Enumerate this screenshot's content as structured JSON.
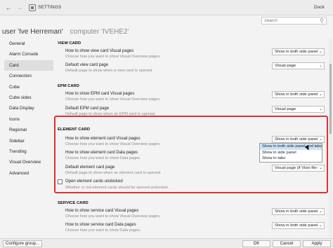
{
  "window": {
    "title": "SETTINGS",
    "dock_label": "Dock"
  },
  "search": {
    "placeholder": "Search"
  },
  "context": {
    "user": "user 'Ive Herreman'",
    "computer": "computer 'IVEHE2'"
  },
  "sidebar": {
    "items": [
      {
        "label": "General"
      },
      {
        "label": "Alarm Console"
      },
      {
        "label": "Card"
      },
      {
        "label": "Connection"
      },
      {
        "label": "Cube"
      },
      {
        "label": "Cube sides"
      },
      {
        "label": "Data Display"
      },
      {
        "label": "Icons"
      },
      {
        "label": "Regional"
      },
      {
        "label": "Sidebar"
      },
      {
        "label": "Trending"
      },
      {
        "label": "Visual Overview"
      },
      {
        "label": "Advanced"
      }
    ],
    "active_index": 2
  },
  "sections": {
    "view_card": {
      "title": "VIEW CARD",
      "s1_label": "How to show view card Visual pages",
      "s1_desc": "Choose how you want to show Visual Overview pages.",
      "s1_value": "Show in both side panel",
      "s2_label": "Default view card page",
      "s2_desc": "Default page to show when a view card is opened.",
      "s2_value": "Visual page"
    },
    "epm_card": {
      "title": "EPM CARD",
      "s1_label": "How to show EPM card Visual pages",
      "s1_desc": "Choose how you want to show Visual Overview pages.",
      "s1_value": "Show in both side panel",
      "s2_label": "Default EPM card page",
      "s2_desc": "Default page to show when an EPM card is opened.",
      "s2_value": "Visual page"
    },
    "element_card": {
      "title": "ELEMENT CARD",
      "s1_label": "How to show element card Visual pages",
      "s1_desc": "Choose how you want to show Visual Overview pages.",
      "s1_value": "Show in both side panel",
      "s2_label": "How to show element card Data pages",
      "s2_desc": "Choose how you want to show Data pages.",
      "s3_label": "Default element card page",
      "s3_desc": "Default page to show when an element card is opened.",
      "s3_value": "Visual page (if Visio file in",
      "chk_label": "Open element cards undocked",
      "chk_desc": "Whether or not element cards should be opened undocked."
    },
    "service_card": {
      "title": "SERVICE CARD",
      "s1_label": "How to show service card Visual pages",
      "s1_desc": "Choose how you want to show Visual Overview pages.",
      "s1_value": "Show in both side panel",
      "s2_label": "How to show service card Data pages",
      "s2_desc": "Choose how you want to show Data pages.",
      "s2_value": "Show in both side panel"
    }
  },
  "dropdown": {
    "options": [
      {
        "label": "Show in both side panel and tabs"
      },
      {
        "label": "Show in side panel"
      },
      {
        "label": "Show in tabs"
      }
    ],
    "selected_index": 0
  },
  "footer": {
    "config_group": "Configure group...",
    "ok": "OK",
    "cancel": "Cancel",
    "apply": "Apply"
  },
  "colors": {
    "highlight": "#e03030",
    "selected_option": "#cce4f7",
    "active_item": "#dedede"
  },
  "icons": {
    "back": "back-arrow-icon",
    "search": "search-icon",
    "dropdown": "chevron-down-icon"
  }
}
